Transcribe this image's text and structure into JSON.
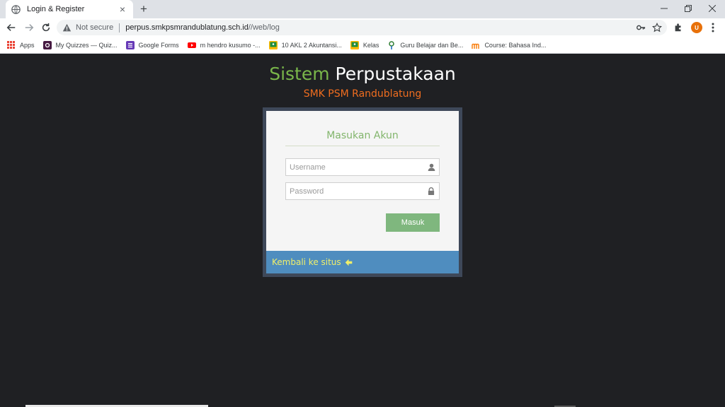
{
  "browser": {
    "tab_title": "Login & Register",
    "tab_close": "×",
    "new_tab": "+",
    "not_secure": "Not secure",
    "url_host": "perpus.smkpsmrandublatung.sch.id",
    "url_path": "//web/log",
    "avatar_letter": "U",
    "bookmarks": [
      {
        "label": "Apps",
        "icon": "apps-grid-icon",
        "color": "#ea4335"
      },
      {
        "label": "My Quizzes — Quiz...",
        "icon": "quizizz-icon",
        "color": "#461a42"
      },
      {
        "label": "Google Forms",
        "icon": "google-forms-icon",
        "color": "#673ab7"
      },
      {
        "label": "m hendro kusumo -...",
        "icon": "youtube-icon",
        "color": "#ff0000"
      },
      {
        "label": "10 AKL 2 Akuntansi...",
        "icon": "classroom-icon",
        "color": "#ffba00"
      },
      {
        "label": "Kelas",
        "icon": "classroom-icon",
        "color": "#ffba00"
      },
      {
        "label": "Guru Belajar dan Be...",
        "icon": "gtk-icon",
        "color": "#2e7d32"
      },
      {
        "label": "Course: Bahasa Ind...",
        "icon": "moodle-icon",
        "color": "#f98012"
      }
    ]
  },
  "page": {
    "title_part1": "Sistem",
    "title_part2": "Perpustakaan",
    "subtitle": "SMK PSM Randublatung",
    "form_title": "Masukan Akun",
    "username_placeholder": "Username",
    "password_placeholder": "Password",
    "submit_label": "Masuk",
    "back_link": "Kembali ke situs"
  },
  "colors": {
    "page_bg": "#1f2023",
    "accent_green": "#79b64a",
    "subtitle_orange": "#ef6d1f",
    "button_green": "#7fb77e",
    "footer_blue": "#4f8dbf",
    "link_yellow": "#f0ef6a"
  }
}
